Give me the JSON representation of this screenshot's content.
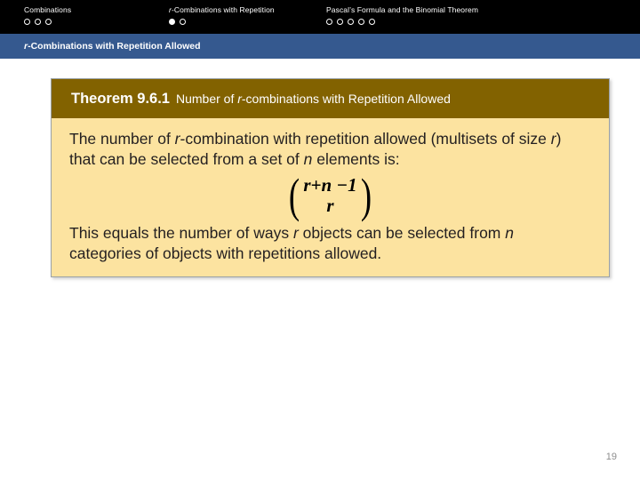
{
  "topnav": {
    "groups": [
      {
        "label_parts": [
          {
            "text": "Combinations",
            "italic": false
          }
        ],
        "label_plain": "Combinations",
        "dots": [
          "hollow",
          "hollow",
          "hollow"
        ]
      },
      {
        "label_parts": [
          {
            "text": "r",
            "italic": true
          },
          {
            "text": "-Combinations with Repetition",
            "italic": false
          }
        ],
        "label_plain": "r-Combinations with Repetition",
        "dots": [
          "filled",
          "hollow"
        ]
      },
      {
        "label_parts": [
          {
            "text": "Pascal’s Formula and the Binomial Theorem",
            "italic": false
          }
        ],
        "label_plain": "Pascal’s Formula and the Binomial Theorem",
        "dots": [
          "hollow",
          "hollow",
          "hollow",
          "hollow",
          "hollow"
        ]
      }
    ],
    "background_color": "#000000",
    "text_color": "#ffffff"
  },
  "section_bar": {
    "title_italic_prefix": "r",
    "title_rest": "-Combinations with Repetition Allowed",
    "title_plain": "r-Combinations with Repetition Allowed",
    "background_color": "#35598f",
    "text_color": "#ffffff"
  },
  "theorem": {
    "header": {
      "number_label": "Theorem 9.6.1",
      "subtitle_pre": "Number of ",
      "subtitle_italic": "r",
      "subtitle_post": "-combinations with Repetition Allowed",
      "subtitle_plain": "Number of r-combinations with Repetition Allowed",
      "background_color": "#826200",
      "text_color": "#ffffff"
    },
    "body": {
      "background_color": "#fce3a0",
      "paragraph1": {
        "seg1": "The number of ",
        "var1": "r",
        "seg2": "-combination with repetition allowed (multisets of size ",
        "var2": "r",
        "seg3": ") that can be selected from a set of ",
        "var3": "n",
        "seg4": " elements is:",
        "plain": "The number of r-combination with repetition allowed (multisets of size r) that can be selected from a set of n elements is:"
      },
      "formula": {
        "notation": "binomial-coefficient",
        "top": "r+n −1",
        "bottom": "r",
        "plain": "(r+n-1 choose r)"
      },
      "paragraph2": {
        "seg1": "This equals the number of ways ",
        "var1": "r",
        "seg2": " objects can be selected from ",
        "var2": "n",
        "seg3": " categories of objects with repetitions allowed.",
        "plain": "This equals the number of ways r objects can be selected from n categories of objects with repetitions allowed."
      }
    }
  },
  "footer": {
    "page_number": "19",
    "color": "#8d8d8d"
  }
}
